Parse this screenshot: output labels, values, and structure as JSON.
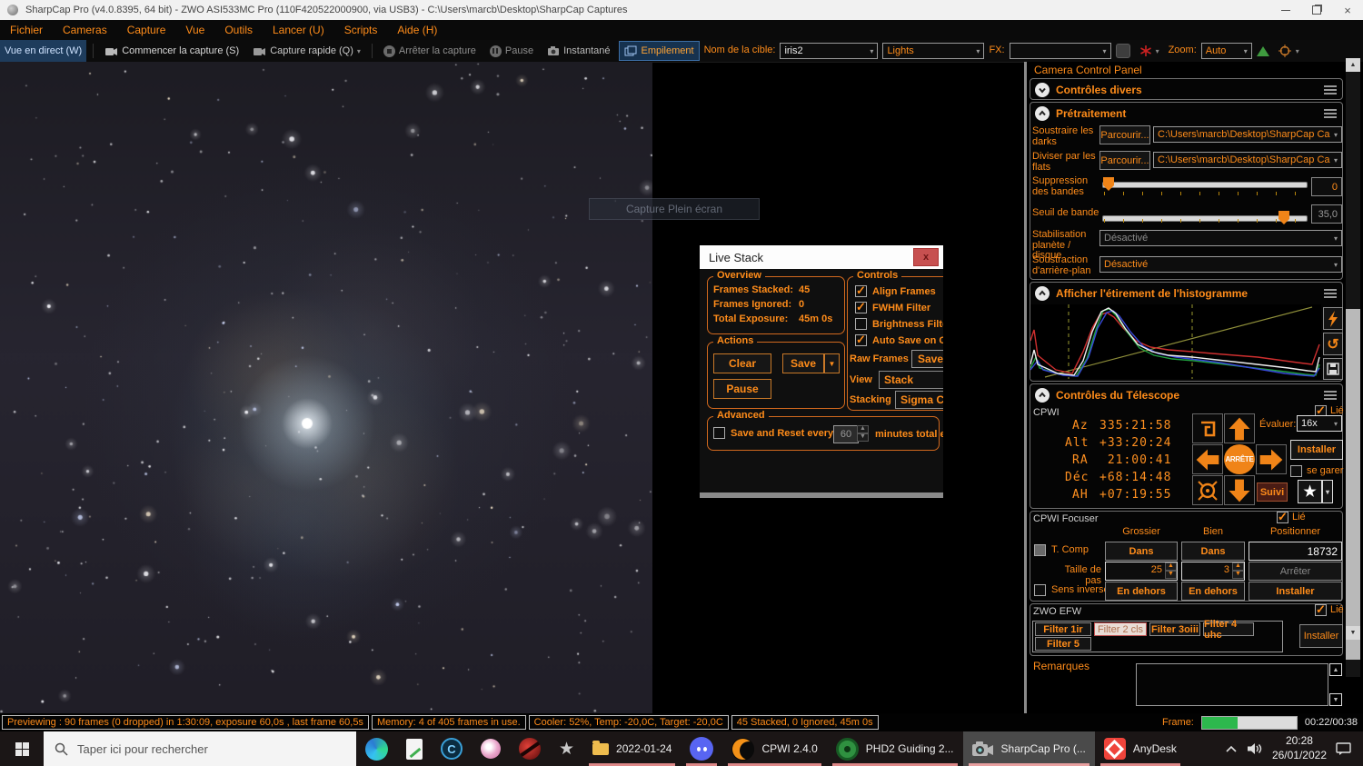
{
  "window": {
    "title": "SharpCap Pro (v4.0.8395, 64 bit) - ZWO ASI533MC Pro (110F420522000900, via USB3) - C:\\Users\\marcb\\Desktop\\SharpCap Captures"
  },
  "menu": {
    "items": [
      "Fichier",
      "Cameras",
      "Capture",
      "Vue",
      "Outils",
      "Lancer (U)",
      "Scripts",
      "Aide (H)"
    ]
  },
  "toolbar": {
    "live_view": "Vue en direct (W)",
    "start_capture": "Commencer la capture (S)",
    "quick_capture": "Capture rapide (Q)",
    "stop_capture": "Arrêter la capture",
    "pause": "Pause",
    "snapshot": "Instantané",
    "stack": "Empilement",
    "target_label": "Nom de la cible:",
    "target_value": "iris2",
    "frame_type": "Lights",
    "fx_label": "FX:",
    "zoom_label": "Zoom:",
    "zoom_value": "Auto"
  },
  "image_area": {
    "ghost_label": "Capture Plein écran"
  },
  "live_stack": {
    "title": "Live Stack",
    "overview": {
      "title": "Overview",
      "frames_stacked_label": "Frames Stacked:",
      "frames_stacked": "45",
      "frames_ignored_label": "Frames Ignored:",
      "frames_ignored": "0",
      "total_exposure_label": "Total Exposure:",
      "total_exposure": "45m 0s"
    },
    "actions": {
      "title": "Actions",
      "clear": "Clear",
      "save": "Save",
      "pause": "Pause"
    },
    "controls": {
      "title": "Controls",
      "align_frames": "Align Frames",
      "fwhm_filter": "FWHM Filter",
      "brightness_filter": "Brightness Filter",
      "auto_save": "Auto Save on Clea",
      "raw_frames_label": "Raw Frames",
      "save_stack": "Save St",
      "view_label": "View",
      "view_value": "Stack",
      "stacking_label": "Stacking",
      "stacking_value": "Sigma Clipp"
    },
    "advanced": {
      "title": "Advanced",
      "save_reset_label": "Save and Reset every",
      "minutes_value": "60",
      "minutes_label": "minutes total exposu"
    }
  },
  "panel": {
    "header": "Camera Control Panel",
    "divers_title": "Contrôles divers",
    "pre": {
      "title": "Prétraitement",
      "darks_label": "Soustraire les darks",
      "flats_label": "Diviser par les flats",
      "browse": "Parcourir...",
      "darks_path": "C:\\Users\\marcb\\Desktop\\SharpCap Ca...",
      "flats_path": "C:\\Users\\marcb\\Desktop\\SharpCap Ca...",
      "banding_label": "Suppression des bandes",
      "banding_value": "0",
      "threshold_label": "Seuil de bande",
      "threshold_value": "35,0",
      "stab_label": "Stabilisation planète / disque",
      "stab_value": "Désactivé",
      "bg_label": "Soustraction d'arrière-plan",
      "bg_value": "Désactivé"
    },
    "histogram_title": "Afficher l'étirement de l'histogramme",
    "telescope": {
      "title": "Contrôles du Télescope",
      "device": "CPWI",
      "linked": "Lié",
      "coords": [
        {
          "label": "Az",
          "value": "335:21:58"
        },
        {
          "label": "Alt",
          "value": "+33:20:24"
        },
        {
          "label": "RA",
          "value": " 21:00:41"
        },
        {
          "label": "Déc",
          "value": "+68:14:48"
        },
        {
          "label": "AH",
          "value": "+07:19:55"
        }
      ],
      "stop": "ARRÊTE",
      "track": "Suivi",
      "rate_label": "Évaluer:",
      "rate_value": "16x",
      "install": "Installer",
      "park": "se garer"
    },
    "focuser": {
      "title": "CPWI Focuser",
      "linked": "Lié",
      "col_coarse": "Grossier",
      "col_fine": "Bien",
      "col_position": "Positionner",
      "tcomp": "T. Comp",
      "in1": "Dans",
      "in2": "Dans",
      "position": "18732",
      "step_label": "Taille de pas",
      "step_coarse": "25",
      "step_fine": "3",
      "stop": "Arrêter",
      "reverse": "Sens inverse",
      "out1": "En dehors",
      "out2": "En dehors",
      "install": "Installer"
    },
    "efw": {
      "title": "ZWO EFW",
      "linked": "Lié",
      "filters": [
        "Filter 1ir",
        "Filter 2 cls",
        "Filter 3oiii",
        "Filter 4 uhc",
        "Filter 5"
      ],
      "install": "Installer"
    },
    "remarks_label": "Remarques"
  },
  "status_bar": {
    "segments": [
      "Previewing : 90 frames (0 dropped) in 1:30:09, exposure 60,0s , last frame 60,5s",
      "Memory: 4 of 405 frames in use.",
      "Cooler: 52%, Temp: -20,0C, Target: -20,0C",
      "45 Stacked, 0 Ignored, 45m 0s"
    ],
    "frame_label": "Frame:",
    "progress_percent": 38,
    "time": "00:22/00:38"
  },
  "taskbar": {
    "search_placeholder": "Taper ici pour rechercher",
    "date_button": "2022-01-24",
    "cpwi": "CPWI 2.4.0",
    "phd2": "PHD2 Guiding 2...",
    "sharpcap": "SharpCap Pro (...",
    "anydesk": "AnyDesk",
    "clock_time": "20:28",
    "clock_date": "26/01/2022"
  },
  "colors": {
    "accent": "#ff8c1a",
    "progress_green": "#2db84d",
    "stack_blue": "#16324f"
  }
}
